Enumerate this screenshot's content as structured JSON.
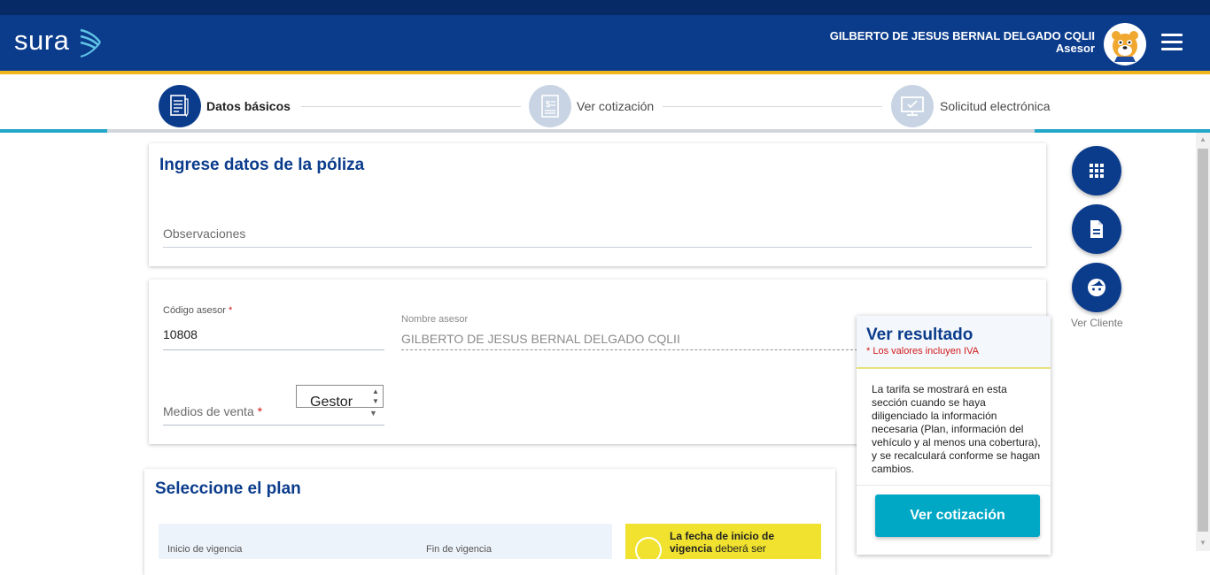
{
  "header": {
    "logo_text": "sura",
    "user_name": "GILBERTO DE JESUS BERNAL DELGADO CQLII",
    "user_role": "Asesor"
  },
  "stepper": {
    "steps": [
      {
        "label": "Datos básicos",
        "state": "active",
        "icon": "form-icon"
      },
      {
        "label": "Ver cotización",
        "state": "inactive",
        "icon": "quote-icon"
      },
      {
        "label": "Solicitud electrónica",
        "state": "inactive",
        "icon": "monitor-icon"
      }
    ]
  },
  "policy_card": {
    "title": "Ingrese datos de la póliza",
    "observaciones_placeholder": "Observaciones"
  },
  "agent_card": {
    "codigo_label": "Código asesor",
    "codigo_value": "10808",
    "nombre_label": "Nombre asesor",
    "nombre_value": "GILBERTO DE JESUS BERNAL DELGADO CQLII",
    "medios_label": "Medios de venta",
    "medios_value": "Gestor",
    "required_mark": "*"
  },
  "plan_card": {
    "title": "Seleccione el plan",
    "inicio_label": "Inicio de vigencia",
    "fin_label": "Fin de vigencia",
    "warning_text_bold": "La fecha de inicio de vigencia",
    "warning_text_rest": " deberá ser"
  },
  "side_actions": {
    "ver_cliente_label": "Ver Cliente"
  },
  "result_panel": {
    "title": "Ver resultado",
    "note": "* Los valores incluyen IVA",
    "body": "La tarifa se mostrará en esta sección cuando se haya diligenciado la información necesaria (Plan, información del vehículo y al menos una cobertura), y se recalculará conforme se hagan cambios.",
    "button_label": "Ver cotización"
  },
  "colors": {
    "brand_blue": "#0b3c8c",
    "gold": "#f0b51c",
    "teal": "#00a8c6",
    "warning_yellow": "#f0e22e"
  }
}
